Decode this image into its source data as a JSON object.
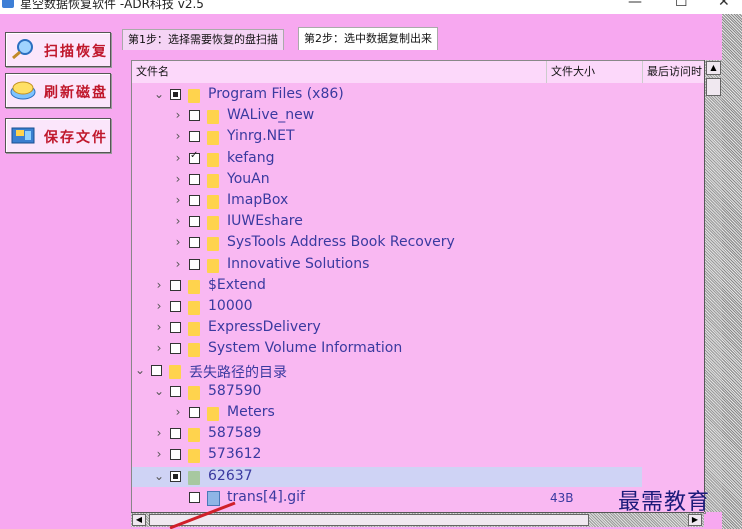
{
  "window": {
    "title": "星空数据恢复软件  -ADR科技 v2.5",
    "min": "—",
    "max": "☐",
    "close": "✕"
  },
  "left_buttons": [
    {
      "label": "扫描恢复",
      "icon": "magnifier-icon"
    },
    {
      "label": "刷新磁盘",
      "icon": "refresh-disk-icon"
    },
    {
      "label": "保存文件",
      "icon": "save-file-icon"
    }
  ],
  "tabs": [
    {
      "label": "第1步：选择需要恢复的盘扫描"
    },
    {
      "label": "第2步：选中数据复制出来"
    }
  ],
  "columns": [
    {
      "label": "文件名"
    },
    {
      "label": "文件大小"
    },
    {
      "label": "最后访问时"
    }
  ],
  "tree": [
    {
      "name": "Program Files (x86)",
      "level": 1,
      "expanded": true,
      "check": "partial"
    },
    {
      "name": "WALive_new",
      "level": 2,
      "expanded": false,
      "check": "none"
    },
    {
      "name": "Yinrg.NET",
      "level": 2,
      "expanded": false,
      "check": "none"
    },
    {
      "name": "kefang",
      "level": 2,
      "expanded": false,
      "check": "checked"
    },
    {
      "name": "YouAn",
      "level": 2,
      "expanded": false,
      "check": "none"
    },
    {
      "name": "ImapBox",
      "level": 2,
      "expanded": false,
      "check": "none"
    },
    {
      "name": "IUWEshare",
      "level": 2,
      "expanded": false,
      "check": "none"
    },
    {
      "name": "SysTools Address Book Recovery",
      "level": 2,
      "expanded": false,
      "check": "none"
    },
    {
      "name": "Innovative Solutions",
      "level": 2,
      "expanded": false,
      "check": "none"
    },
    {
      "name": "$Extend",
      "level": 1,
      "expanded": false,
      "check": "none"
    },
    {
      "name": "10000",
      "level": 1,
      "expanded": false,
      "check": "none"
    },
    {
      "name": "ExpressDelivery",
      "level": 1,
      "expanded": false,
      "check": "none"
    },
    {
      "name": "System Volume Information",
      "level": 1,
      "expanded": false,
      "check": "none"
    },
    {
      "name": "丢失路径的目录",
      "level": 0,
      "expanded": true,
      "check": "none"
    },
    {
      "name": "587590",
      "level": 1,
      "expanded": true,
      "check": "none"
    },
    {
      "name": "Meters",
      "level": 2,
      "expanded": false,
      "check": "none"
    },
    {
      "name": "587589",
      "level": 1,
      "expanded": false,
      "check": "none"
    },
    {
      "name": "573612",
      "level": 1,
      "expanded": false,
      "check": "none"
    },
    {
      "name": "62637",
      "level": 1,
      "expanded": true,
      "check": "partial",
      "selected": true,
      "folder_color": "gray"
    },
    {
      "name": "trans[4].gif",
      "level": 2,
      "type": "file",
      "check": "none",
      "size": "43B"
    }
  ],
  "watermark": "最需教育",
  "colors": {
    "background": "#f7a8f0",
    "panel": "#f9b8f2",
    "tree_text": "#3a3aa0",
    "button_text": "#c0182c",
    "selection": "#cfd3f5"
  }
}
